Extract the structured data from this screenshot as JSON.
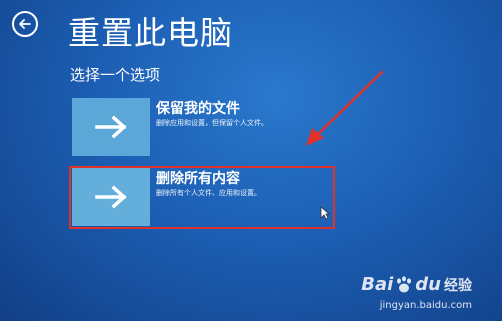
{
  "page": {
    "title": "重置此电脑",
    "subtitle": "选择一个选项",
    "back_icon": "back-arrow-icon"
  },
  "options": [
    {
      "title": "保留我的文件",
      "description": "删除应用和设置，但保留个人文件。",
      "icon": "right-arrow-icon"
    },
    {
      "title": "删除所有内容",
      "description": "删除所有个人文件、应用和设置。",
      "icon": "right-arrow-icon"
    }
  ],
  "annotation": {
    "highlight_color": "#e0322a",
    "arrow_color": "#e0322a"
  },
  "watermark": {
    "brand_left": "Bai",
    "brand_right": "du",
    "suffix": "经验",
    "url": "jingyan.baidu.com"
  },
  "colors": {
    "background": "#1c5fb4",
    "tile": "#5aa7d8",
    "text": "#ffffff"
  }
}
